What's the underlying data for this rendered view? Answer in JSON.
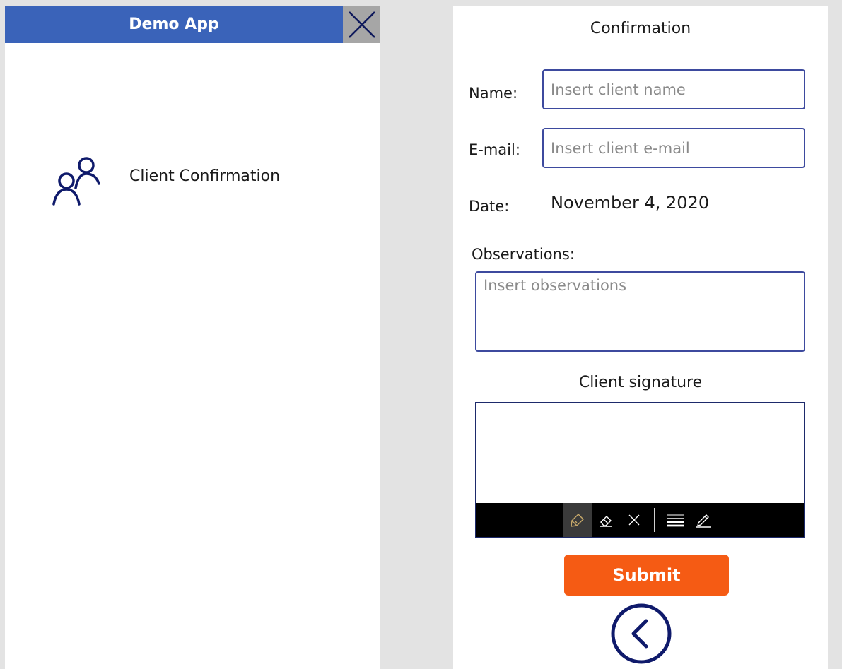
{
  "app": {
    "title": "Demo App",
    "header_color": "#3a63b9"
  },
  "left_panel": {
    "close_icon": "close-icon",
    "menu_items": [
      {
        "label": "Client Confirmation",
        "icon": "people-icon"
      }
    ]
  },
  "form": {
    "title": "Confirmation",
    "name_label": "Name:",
    "name_placeholder": "Insert client name",
    "name_value": "",
    "email_label": "E-mail:",
    "email_placeholder": "Insert client e-mail",
    "email_value": "",
    "date_label": "Date:",
    "date_value": "November 4, 2020",
    "observations_label": "Observations:",
    "observations_placeholder": "Insert observations",
    "observations_value": "",
    "signature_title": "Client signature",
    "signature_tools": [
      "pen-icon",
      "eraser-icon",
      "clear-icon",
      "stroke-width-icon",
      "pen-color-icon"
    ],
    "submit_label": "Submit",
    "back_icon": "chevron-left-circle-icon"
  },
  "colors": {
    "accent": "#1d2a6b",
    "submit": "#f55b14",
    "toolbar": "#000000"
  }
}
